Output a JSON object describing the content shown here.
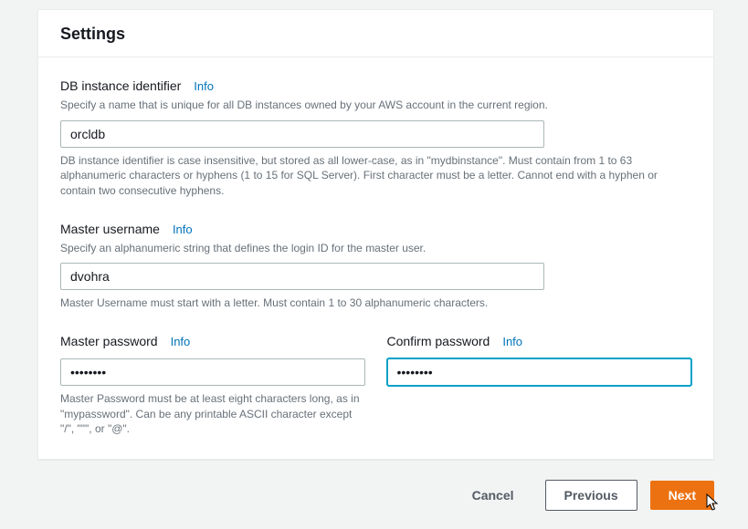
{
  "panel": {
    "title": "Settings"
  },
  "info_label": "Info",
  "db_identifier": {
    "label": "DB instance identifier",
    "desc": "Specify a name that is unique for all DB instances owned by your AWS account in the current region.",
    "value": "orcldb",
    "help": "DB instance identifier is case insensitive, but stored as all lower-case, as in \"mydbinstance\". Must contain from 1 to 63 alphanumeric characters or hyphens (1 to 15 for SQL Server). First character must be a letter. Cannot end with a hyphen or contain two consecutive hyphens."
  },
  "master_username": {
    "label": "Master username",
    "desc": "Specify an alphanumeric string that defines the login ID for the master user.",
    "value": "dvohra",
    "help": "Master Username must start with a letter. Must contain 1 to 30 alphanumeric characters."
  },
  "master_password": {
    "label": "Master password",
    "value": "••••••••",
    "help": "Master Password must be at least eight characters long, as in \"mypassword\". Can be any printable ASCII character except \"/\", \"\"\", or \"@\"."
  },
  "confirm_password": {
    "label": "Confirm password",
    "value": "••••••••"
  },
  "buttons": {
    "cancel": "Cancel",
    "previous": "Previous",
    "next": "Next"
  }
}
